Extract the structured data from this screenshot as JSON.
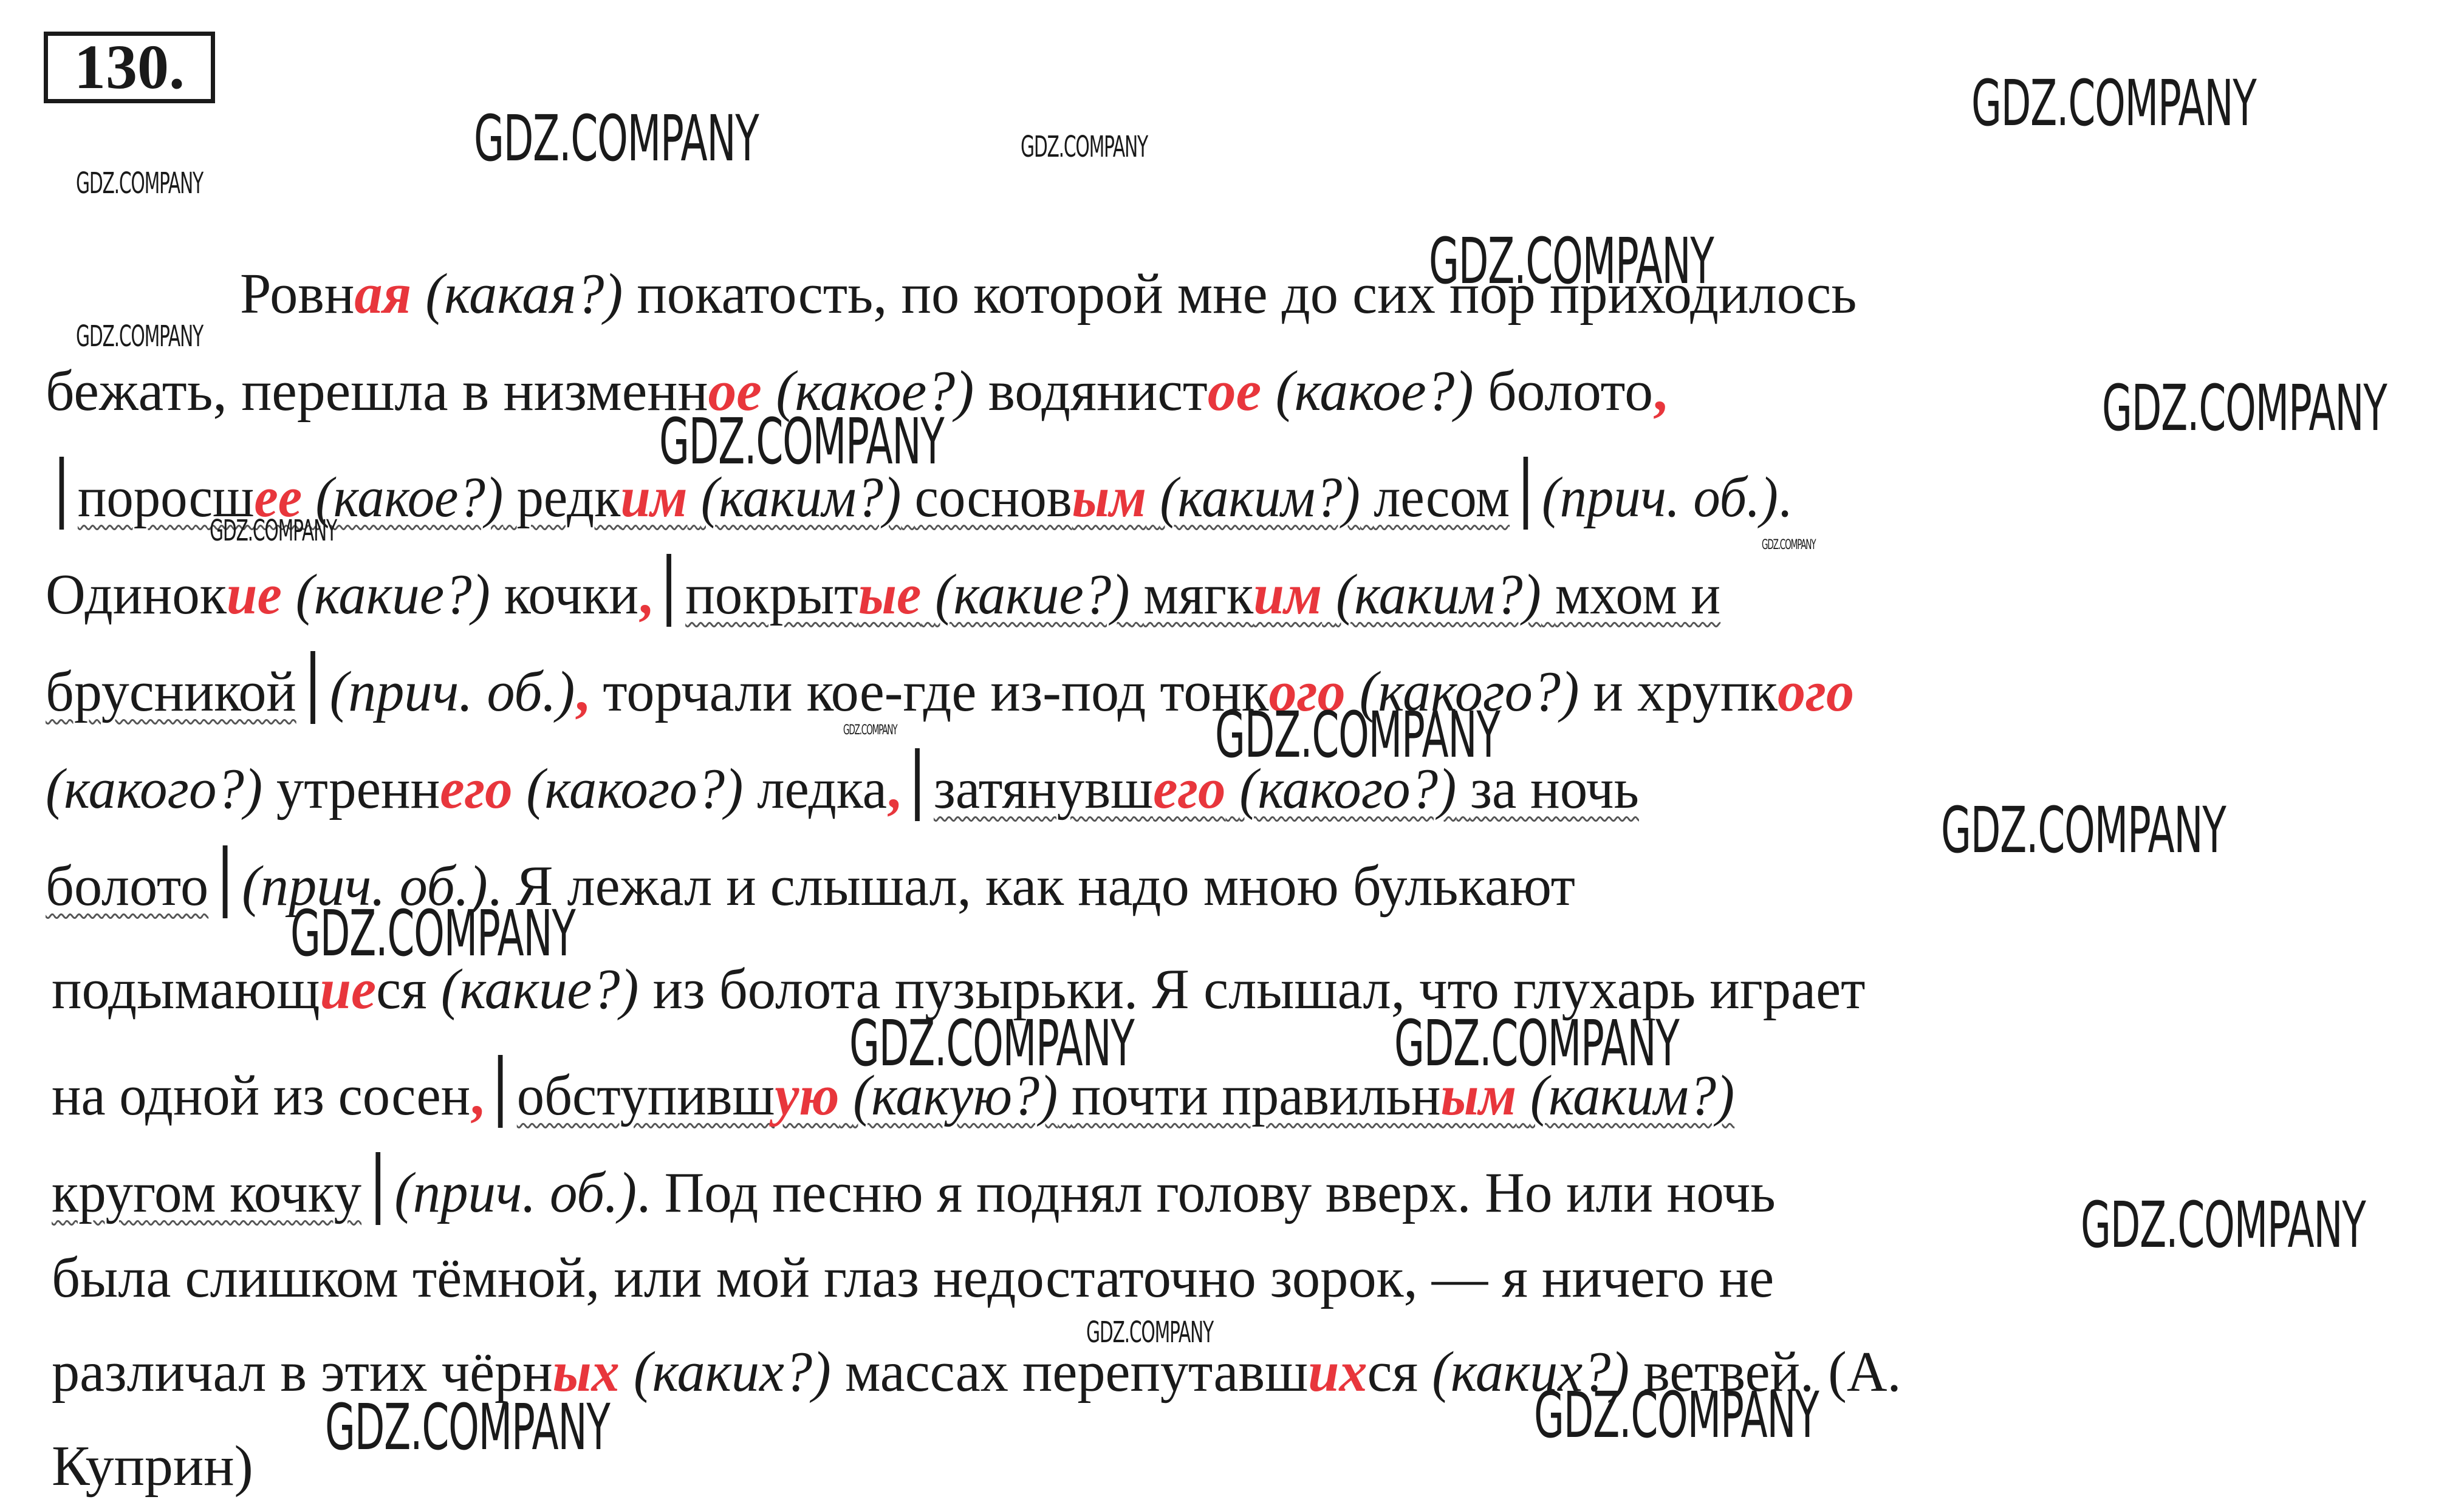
{
  "exercise_number": "130.",
  "watermark": "GDZ.COMPANY",
  "t": {
    "s1": "Ровн",
    "e1": "ая",
    "q1": "(какая?)",
    "s2": "покатость, по которой мне до сих пор приходилось",
    "s3": "бежать, перешла в низменн",
    "e3": "ое",
    "q3": "(какое?)",
    "s4": "водянист",
    "e4": "ое",
    "q4": "(какое?)",
    "s5": "болото",
    "p5": ",",
    "s6": "поросш",
    "e6": "ее",
    "q6": "(какое?)",
    "s7": "редк",
    "e7": "им",
    "q7": "(каким?)",
    "s8": "соснов",
    "e8": "ым",
    "q8": "(каким?)",
    "s9": "лесом",
    "o9": "(прич. об.)",
    "d9": ".",
    "s10": "Одинок",
    "e10": "ие",
    "q10": "(какие?)",
    "s11": "кочки",
    "p11": ",",
    "s12": "покрыт",
    "e12": "ые",
    "q12": "(какие?)",
    "s13": "мягк",
    "e13": "им",
    "q13": "(каким?)",
    "s14": "мхом и",
    "s15": "брусникой",
    "o15": "(прич. об.)",
    "p15": ",",
    "s16": "торчали кое-где из-под тонк",
    "e16": "ого",
    "q16": "(какого?)",
    "s17": "и хрупк",
    "e17": "ого",
    "q17": "(какого?)",
    "s18": "утренн",
    "e18": "его",
    "q18": "(какого?)",
    "s19": "ледка",
    "p19": ",",
    "s20": "затянувш",
    "e20": "его",
    "q20": "(какого?)",
    "s21": "за ночь",
    "s22": "болото",
    "o22": "(прич. об.)",
    "s23": ". Я лежал и слышал, как надо мною булькают",
    "s24": "подымающ",
    "e24": "ие",
    "s24b": "ся",
    "q24": "(какие?)",
    "s25": "из болота пузырьки. Я слышал, что глухарь играет",
    "s26": "на одной из сосен",
    "p26": ",",
    "s27": "обступивш",
    "e27": "ую",
    "q27": "(какую?)",
    "s28": "почти правильн",
    "e28": "ым",
    "q28": "(каким?)",
    "s29": "кругом кочку",
    "o29": "(прич. об.)",
    "s30": ". Под песню я поднял голову вверх. Но или ночь",
    "s31": "была слишком тёмной, или мой глаз недостаточно зорок, — я ничего не",
    "s32": "различал в этих чёрн",
    "e32": "ых",
    "q32": "(каких?)",
    "s33": "массах перепутавш",
    "e33": "их",
    "s33b": "ся",
    "q33": "(каких?)",
    "s34": "ветвей. (А.",
    "s35": "Куприн)"
  }
}
